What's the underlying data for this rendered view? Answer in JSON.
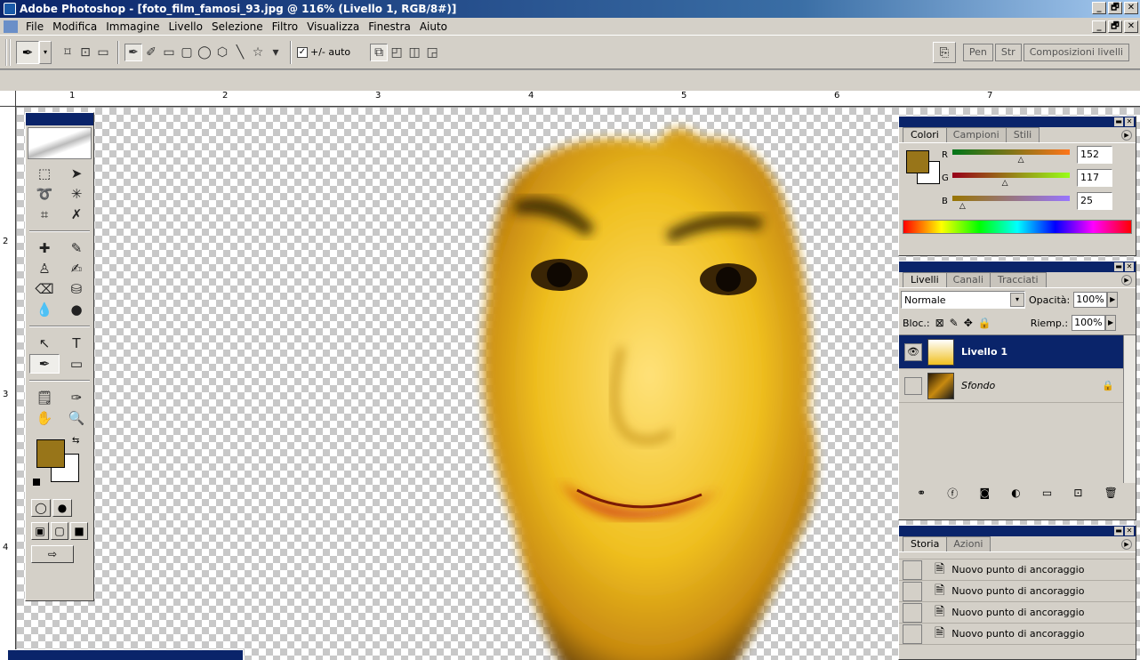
{
  "window": {
    "title": "Adobe Photoshop - [foto_film_famosi_93.jpg @ 116% (Livello 1, RGB/8#)]",
    "buttons": [
      "_",
      "🗗",
      "✕"
    ]
  },
  "menu": {
    "items": [
      "File",
      "Modifica",
      "Immagine",
      "Livello",
      "Selezione",
      "Filtro",
      "Visualizza",
      "Finestra",
      "Aiuto"
    ],
    "doc_buttons": [
      "_",
      "🗗",
      "✕"
    ]
  },
  "options": {
    "auto_label": "+/- auto",
    "auto_checked": "✓",
    "palette_tabs": [
      "Pen",
      "Str",
      "Composizioni livelli"
    ]
  },
  "rulers": {
    "h_labels": [
      "1",
      "2",
      "3",
      "4",
      "5",
      "6",
      "7"
    ],
    "v_labels": [
      "2",
      "3",
      "4"
    ]
  },
  "colors_panel": {
    "tabs": [
      "Colori",
      "Campioni",
      "Stili"
    ],
    "r_label": "R",
    "g_label": "G",
    "b_label": "B",
    "r": "152",
    "g": "117",
    "b": "25",
    "r_level": 0.596,
    "g_level": 0.459,
    "b_level": 0.098,
    "foreground": "#987519",
    "background": "#ffffff"
  },
  "layers_panel": {
    "tabs": [
      "Livelli",
      "Canali",
      "Tracciati"
    ],
    "blend_mode": "Normale",
    "opacity_label": "Opacità:",
    "opacity": "100%",
    "lock_label": "Bloc.:",
    "fill_label": "Riemp.:",
    "fill": "100%",
    "layers": [
      {
        "name": "Livello 1",
        "visible": "👁"
      },
      {
        "name": "Sfondo",
        "lock": "🔒"
      }
    ]
  },
  "history_panel": {
    "tabs": [
      "Storia",
      "Azioni"
    ],
    "items": [
      "Nuovo punto di ancoraggio",
      "Nuovo punto di ancoraggio",
      "Nuovo punto di ancoraggio",
      "Nuovo punto di ancoraggio"
    ]
  },
  "icons": {
    "pen": "✒",
    "dropdown": "▾",
    "text": "T",
    "hand": "✋",
    "zoom": "🔍",
    "swap": "⇆"
  },
  "accent": "#0a246a"
}
